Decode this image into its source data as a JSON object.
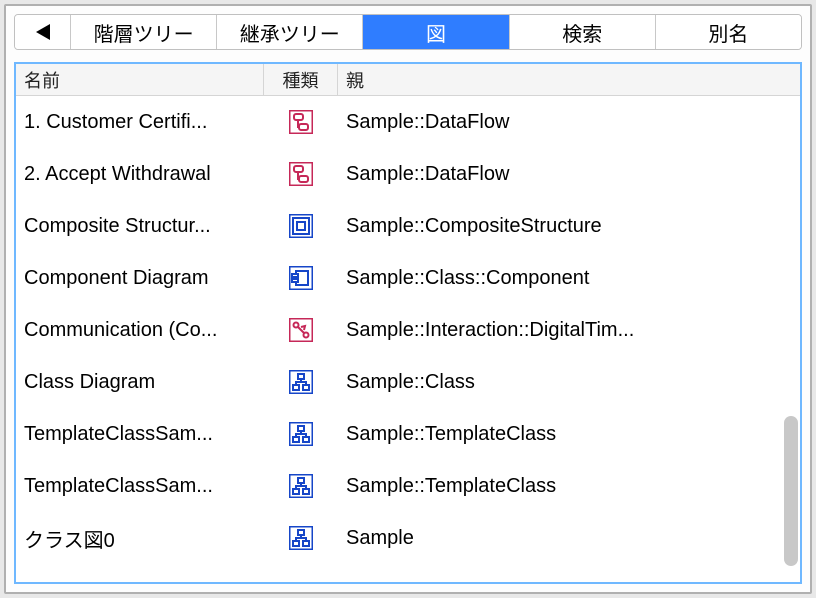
{
  "tabs": {
    "items": [
      {
        "label": "階層ツリー",
        "active": false
      },
      {
        "label": "継承ツリー",
        "active": false
      },
      {
        "label": "図",
        "active": true
      },
      {
        "label": "検索",
        "active": false
      },
      {
        "label": "別名",
        "active": false
      }
    ]
  },
  "columns": {
    "name": "名前",
    "type": "種類",
    "parent": "親"
  },
  "rows": [
    {
      "name": "1. Customer Certifi...",
      "icon": "dataflow",
      "parent": "Sample::DataFlow"
    },
    {
      "name": "2. Accept Withdrawal",
      "icon": "dataflow",
      "parent": "Sample::DataFlow"
    },
    {
      "name": "Composite Structur...",
      "icon": "composite",
      "parent": "Sample::CompositeStructure"
    },
    {
      "name": "Component Diagram",
      "icon": "component",
      "parent": "Sample::Class::Component"
    },
    {
      "name": "Communication (Co...",
      "icon": "communication",
      "parent": "Sample::Interaction::DigitalTim..."
    },
    {
      "name": "Class Diagram",
      "icon": "class",
      "parent": "Sample::Class"
    },
    {
      "name": "TemplateClassSam...",
      "icon": "class",
      "parent": "Sample::TemplateClass"
    },
    {
      "name": "TemplateClassSam...",
      "icon": "class",
      "parent": "Sample::TemplateClass"
    },
    {
      "name": "クラス図0",
      "icon": "class",
      "parent": "Sample"
    }
  ],
  "icon_colors": {
    "red": "#c62858",
    "blue": "#1646c8"
  }
}
